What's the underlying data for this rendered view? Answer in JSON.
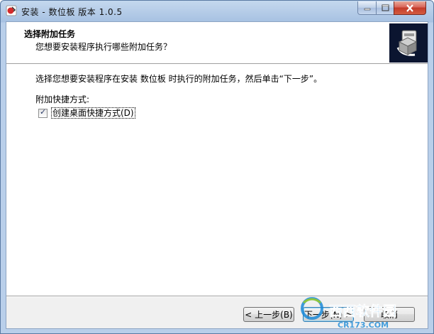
{
  "window": {
    "title": "安装 - 数位板 版本 1.0.5",
    "controls": {
      "minimize": "minimize",
      "maximize": "maximize",
      "close": "close"
    }
  },
  "header": {
    "title": "选择附加任务",
    "subtitle": "您想要安装程序执行哪些附加任务？"
  },
  "page": {
    "description": "选择您想要安装程序在安装 数位板 时执行的附加任务，然后单击“下一步”。",
    "group_label": "附加快捷方式:",
    "tasks": [
      {
        "label": "创建桌面快捷方式(D)",
        "checked": true
      }
    ]
  },
  "buttons": {
    "back": "< 上一步(B)",
    "next": "下一步(N) >",
    "cancel": "取消"
  },
  "watermark": {
    "brand": "西西软件园",
    "site": "CR173.COM"
  },
  "colors": {
    "accent": "#3c7fb1",
    "close": "#c23b2a",
    "watermark": "#1b8ad8"
  }
}
